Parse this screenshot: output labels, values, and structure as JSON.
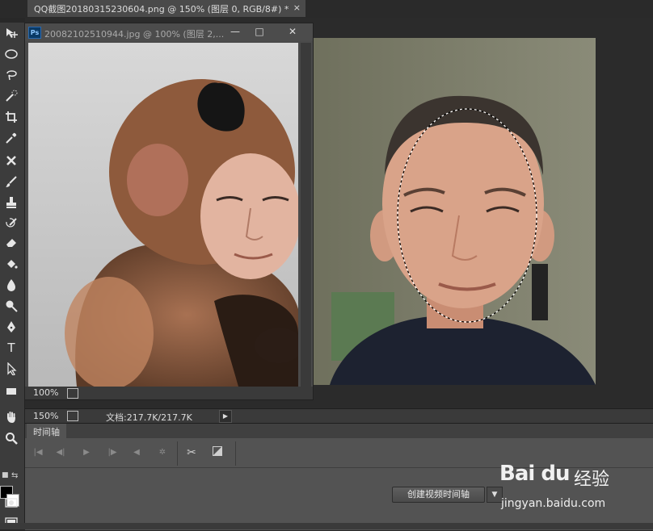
{
  "main_document": {
    "tab_title": "QQ截图20180315230604.png @ 150% (图层 0, RGB/8#) *",
    "close_glyph": "×",
    "zoom": "150%",
    "doc_info": "文档:217.7K/217.7K",
    "arrow": "▶"
  },
  "floating_document": {
    "app_badge": "Ps",
    "title": "20082102510944.jpg @ 100% (图层 2,...",
    "minimize": "—",
    "maximize": "□",
    "close": "✕",
    "zoom": "100%"
  },
  "timeline": {
    "tab_label": "时间轴",
    "create_button": "创建视频时间轴",
    "dropdown_glyph": "▼"
  },
  "toolbar": {
    "tools": [
      "move-tool",
      "elliptical-marquee-tool",
      "lasso-tool",
      "quick-selection-tool",
      "crop-tool",
      "eyedropper-tool",
      "spot-healing-tool",
      "brush-tool",
      "clone-stamp-tool",
      "history-brush-tool",
      "eraser-tool",
      "paint-bucket-tool",
      "blur-tool",
      "dodge-tool",
      "pen-tool",
      "type-tool",
      "path-selection-tool",
      "rectangle-tool",
      "hand-tool",
      "zoom-tool"
    ],
    "type_glyph": "T",
    "foreground_color": "#000000",
    "background_color": "#ffffff"
  },
  "watermark": {
    "logo": "Bai du",
    "brand_cn": "经验",
    "url": "jingyan.baidu.com"
  }
}
